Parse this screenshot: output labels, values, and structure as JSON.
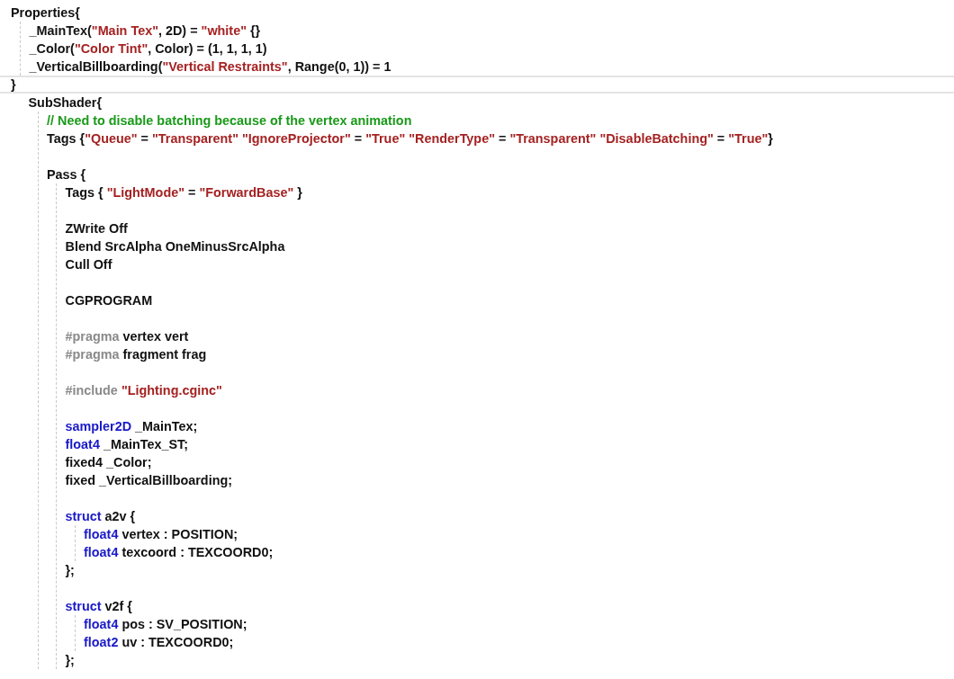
{
  "editor": {
    "lines": [
      {
        "selected": false,
        "tokens": [
          {
            "kind": "plain",
            "text": "Properties{"
          }
        ],
        "children": [
          {
            "selected": false,
            "tokens": [
              {
                "kind": "plain",
                "text": "_MainTex("
              },
              {
                "kind": "string",
                "text": "\"Main Tex\""
              },
              {
                "kind": "plain",
                "text": ", 2D) = "
              },
              {
                "kind": "string",
                "text": "\"white\""
              },
              {
                "kind": "plain",
                "text": " {}"
              }
            ]
          },
          {
            "selected": false,
            "tokens": [
              {
                "kind": "plain",
                "text": "_Color("
              },
              {
                "kind": "string",
                "text": "\"Color Tint\""
              },
              {
                "kind": "plain",
                "text": ", Color) = (1, 1, 1, 1)"
              }
            ]
          },
          {
            "selected": false,
            "tokens": [
              {
                "kind": "plain",
                "text": "_VerticalBillboarding("
              },
              {
                "kind": "string",
                "text": "\"Vertical Restraints\""
              },
              {
                "kind": "plain",
                "text": ", Range(0, 1)) = 1"
              }
            ]
          }
        ]
      },
      {
        "selected": true,
        "tokens": [
          {
            "kind": "plain",
            "text": "}"
          }
        ]
      },
      {
        "children": [
          {
            "selected": false,
            "tokens": [
              {
                "kind": "plain",
                "text": "SubShader{"
              }
            ],
            "children": [
              {
                "selected": false,
                "tokens": [
                  {
                    "kind": "comment",
                    "text": "// Need to disable batching because of the vertex animation"
                  }
                ]
              },
              {
                "selected": false,
                "tokens": [
                  {
                    "kind": "plain",
                    "text": "Tags {"
                  },
                  {
                    "kind": "string",
                    "text": "\"Queue\""
                  },
                  {
                    "kind": "plain",
                    "text": " = "
                  },
                  {
                    "kind": "string",
                    "text": "\"Transparent\" \"IgnoreProjector\""
                  },
                  {
                    "kind": "plain",
                    "text": " = "
                  },
                  {
                    "kind": "string",
                    "text": "\"True\" \"RenderType\""
                  },
                  {
                    "kind": "plain",
                    "text": " = "
                  },
                  {
                    "kind": "string",
                    "text": "\"Transparent\" \"DisableBatching\""
                  },
                  {
                    "kind": "plain",
                    "text": " = "
                  },
                  {
                    "kind": "string",
                    "text": "\"True\""
                  },
                  {
                    "kind": "plain",
                    "text": "}"
                  }
                ]
              },
              {
                "selected": false
              },
              {
                "selected": false,
                "tokens": [
                  {
                    "kind": "plain",
                    "text": "Pass {"
                  }
                ],
                "children": [
                  {
                    "selected": false,
                    "tokens": [
                      {
                        "kind": "plain",
                        "text": "Tags { "
                      },
                      {
                        "kind": "string",
                        "text": "\"LightMode\""
                      },
                      {
                        "kind": "plain",
                        "text": " = "
                      },
                      {
                        "kind": "string",
                        "text": "\"ForwardBase\""
                      },
                      {
                        "kind": "plain",
                        "text": " }"
                      }
                    ]
                  },
                  {
                    "selected": false
                  },
                  {
                    "selected": false,
                    "tokens": [
                      {
                        "kind": "plain",
                        "text": "ZWrite Off"
                      }
                    ]
                  },
                  {
                    "selected": false,
                    "tokens": [
                      {
                        "kind": "plain",
                        "text": "Blend SrcAlpha OneMinusSrcAlpha"
                      }
                    ]
                  },
                  {
                    "selected": false,
                    "tokens": [
                      {
                        "kind": "plain",
                        "text": "Cull Off"
                      }
                    ]
                  },
                  {
                    "selected": false
                  },
                  {
                    "selected": false,
                    "tokens": [
                      {
                        "kind": "plain",
                        "text": "CGPROGRAM"
                      }
                    ]
                  },
                  {
                    "selected": false
                  },
                  {
                    "selected": false,
                    "tokens": [
                      {
                        "kind": "preproc",
                        "text": "#pragma"
                      },
                      {
                        "kind": "plain",
                        "text": " vertex vert"
                      }
                    ]
                  },
                  {
                    "selected": false,
                    "tokens": [
                      {
                        "kind": "preproc",
                        "text": "#pragma"
                      },
                      {
                        "kind": "plain",
                        "text": " fragment frag"
                      }
                    ]
                  },
                  {
                    "selected": false
                  },
                  {
                    "selected": false,
                    "tokens": [
                      {
                        "kind": "preproc",
                        "text": "#include"
                      },
                      {
                        "kind": "string",
                        "text": " \"Lighting.cginc\""
                      }
                    ]
                  },
                  {
                    "selected": false
                  },
                  {
                    "selected": false,
                    "tokens": [
                      {
                        "kind": "keyword",
                        "text": "sampler2D"
                      },
                      {
                        "kind": "plain",
                        "text": " _MainTex;"
                      }
                    ]
                  },
                  {
                    "selected": false,
                    "tokens": [
                      {
                        "kind": "keyword",
                        "text": "float4"
                      },
                      {
                        "kind": "plain",
                        "text": " _MainTex_ST;"
                      }
                    ]
                  },
                  {
                    "selected": false,
                    "tokens": [
                      {
                        "kind": "plain",
                        "text": "fixed4 _Color;"
                      }
                    ]
                  },
                  {
                    "selected": false,
                    "tokens": [
                      {
                        "kind": "plain",
                        "text": "fixed _VerticalBillboarding;"
                      }
                    ]
                  },
                  {
                    "selected": false
                  },
                  {
                    "selected": false,
                    "tokens": [
                      {
                        "kind": "keyword",
                        "text": "struct"
                      },
                      {
                        "kind": "plain",
                        "text": " a2v {"
                      }
                    ],
                    "children": [
                      {
                        "selected": false,
                        "tokens": [
                          {
                            "kind": "keyword",
                            "text": "float4"
                          },
                          {
                            "kind": "plain",
                            "text": " vertex : POSITION;"
                          }
                        ]
                      },
                      {
                        "selected": false,
                        "tokens": [
                          {
                            "kind": "keyword",
                            "text": "float4"
                          },
                          {
                            "kind": "plain",
                            "text": " texcoord : TEXCOORD0;"
                          }
                        ]
                      }
                    ]
                  },
                  {
                    "selected": false,
                    "tokens": [
                      {
                        "kind": "plain",
                        "text": "};"
                      }
                    ]
                  },
                  {
                    "selected": false
                  },
                  {
                    "selected": false,
                    "tokens": [
                      {
                        "kind": "keyword",
                        "text": "struct"
                      },
                      {
                        "kind": "plain",
                        "text": " v2f {"
                      }
                    ],
                    "children": [
                      {
                        "selected": false,
                        "tokens": [
                          {
                            "kind": "keyword",
                            "text": "float4"
                          },
                          {
                            "kind": "plain",
                            "text": " pos : SV_POSITION;"
                          }
                        ]
                      },
                      {
                        "selected": false,
                        "tokens": [
                          {
                            "kind": "keyword",
                            "text": "float2"
                          },
                          {
                            "kind": "plain",
                            "text": " uv : TEXCOORD0;"
                          }
                        ]
                      }
                    ]
                  },
                  {
                    "selected": false,
                    "tokens": [
                      {
                        "kind": "plain",
                        "text": "};"
                      }
                    ]
                  }
                ]
              }
            ]
          }
        ]
      }
    ]
  }
}
